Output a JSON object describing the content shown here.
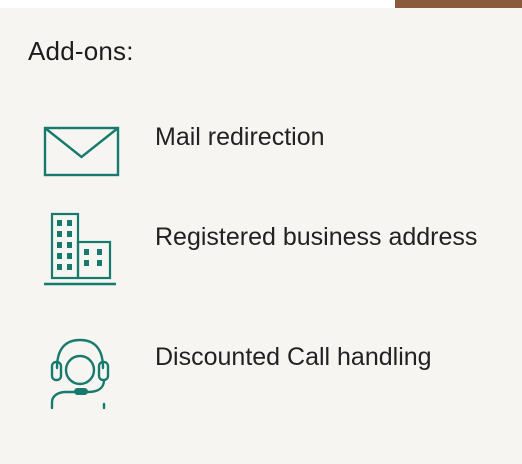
{
  "section": {
    "title": "Add-ons:"
  },
  "addons": [
    {
      "icon": "envelope-icon",
      "label": "Mail redirection"
    },
    {
      "icon": "office-building-icon",
      "label": "Registered business address"
    },
    {
      "icon": "headset-operator-icon",
      "label": "Discounted Call handling"
    }
  ],
  "colors": {
    "icon": "#177a6e",
    "background": "#f7f5f1",
    "text": "#222222",
    "accent": "#8a5a3b"
  }
}
